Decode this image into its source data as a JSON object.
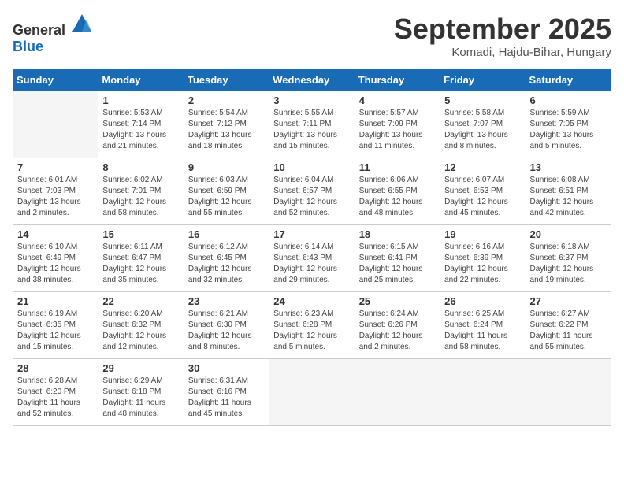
{
  "logo": {
    "text_general": "General",
    "text_blue": "Blue"
  },
  "header": {
    "month": "September 2025",
    "location": "Komadi, Hajdu-Bihar, Hungary"
  },
  "weekdays": [
    "Sunday",
    "Monday",
    "Tuesday",
    "Wednesday",
    "Thursday",
    "Friday",
    "Saturday"
  ],
  "weeks": [
    [
      {
        "day": "",
        "sunrise": "",
        "sunset": "",
        "daylight": ""
      },
      {
        "day": "1",
        "sunrise": "Sunrise: 5:53 AM",
        "sunset": "Sunset: 7:14 PM",
        "daylight": "Daylight: 13 hours and 21 minutes."
      },
      {
        "day": "2",
        "sunrise": "Sunrise: 5:54 AM",
        "sunset": "Sunset: 7:12 PM",
        "daylight": "Daylight: 13 hours and 18 minutes."
      },
      {
        "day": "3",
        "sunrise": "Sunrise: 5:55 AM",
        "sunset": "Sunset: 7:11 PM",
        "daylight": "Daylight: 13 hours and 15 minutes."
      },
      {
        "day": "4",
        "sunrise": "Sunrise: 5:57 AM",
        "sunset": "Sunset: 7:09 PM",
        "daylight": "Daylight: 13 hours and 11 minutes."
      },
      {
        "day": "5",
        "sunrise": "Sunrise: 5:58 AM",
        "sunset": "Sunset: 7:07 PM",
        "daylight": "Daylight: 13 hours and 8 minutes."
      },
      {
        "day": "6",
        "sunrise": "Sunrise: 5:59 AM",
        "sunset": "Sunset: 7:05 PM",
        "daylight": "Daylight: 13 hours and 5 minutes."
      }
    ],
    [
      {
        "day": "7",
        "sunrise": "Sunrise: 6:01 AM",
        "sunset": "Sunset: 7:03 PM",
        "daylight": "Daylight: 13 hours and 2 minutes."
      },
      {
        "day": "8",
        "sunrise": "Sunrise: 6:02 AM",
        "sunset": "Sunset: 7:01 PM",
        "daylight": "Daylight: 12 hours and 58 minutes."
      },
      {
        "day": "9",
        "sunrise": "Sunrise: 6:03 AM",
        "sunset": "Sunset: 6:59 PM",
        "daylight": "Daylight: 12 hours and 55 minutes."
      },
      {
        "day": "10",
        "sunrise": "Sunrise: 6:04 AM",
        "sunset": "Sunset: 6:57 PM",
        "daylight": "Daylight: 12 hours and 52 minutes."
      },
      {
        "day": "11",
        "sunrise": "Sunrise: 6:06 AM",
        "sunset": "Sunset: 6:55 PM",
        "daylight": "Daylight: 12 hours and 48 minutes."
      },
      {
        "day": "12",
        "sunrise": "Sunrise: 6:07 AM",
        "sunset": "Sunset: 6:53 PM",
        "daylight": "Daylight: 12 hours and 45 minutes."
      },
      {
        "day": "13",
        "sunrise": "Sunrise: 6:08 AM",
        "sunset": "Sunset: 6:51 PM",
        "daylight": "Daylight: 12 hours and 42 minutes."
      }
    ],
    [
      {
        "day": "14",
        "sunrise": "Sunrise: 6:10 AM",
        "sunset": "Sunset: 6:49 PM",
        "daylight": "Daylight: 12 hours and 38 minutes."
      },
      {
        "day": "15",
        "sunrise": "Sunrise: 6:11 AM",
        "sunset": "Sunset: 6:47 PM",
        "daylight": "Daylight: 12 hours and 35 minutes."
      },
      {
        "day": "16",
        "sunrise": "Sunrise: 6:12 AM",
        "sunset": "Sunset: 6:45 PM",
        "daylight": "Daylight: 12 hours and 32 minutes."
      },
      {
        "day": "17",
        "sunrise": "Sunrise: 6:14 AM",
        "sunset": "Sunset: 6:43 PM",
        "daylight": "Daylight: 12 hours and 29 minutes."
      },
      {
        "day": "18",
        "sunrise": "Sunrise: 6:15 AM",
        "sunset": "Sunset: 6:41 PM",
        "daylight": "Daylight: 12 hours and 25 minutes."
      },
      {
        "day": "19",
        "sunrise": "Sunrise: 6:16 AM",
        "sunset": "Sunset: 6:39 PM",
        "daylight": "Daylight: 12 hours and 22 minutes."
      },
      {
        "day": "20",
        "sunrise": "Sunrise: 6:18 AM",
        "sunset": "Sunset: 6:37 PM",
        "daylight": "Daylight: 12 hours and 19 minutes."
      }
    ],
    [
      {
        "day": "21",
        "sunrise": "Sunrise: 6:19 AM",
        "sunset": "Sunset: 6:35 PM",
        "daylight": "Daylight: 12 hours and 15 minutes."
      },
      {
        "day": "22",
        "sunrise": "Sunrise: 6:20 AM",
        "sunset": "Sunset: 6:32 PM",
        "daylight": "Daylight: 12 hours and 12 minutes."
      },
      {
        "day": "23",
        "sunrise": "Sunrise: 6:21 AM",
        "sunset": "Sunset: 6:30 PM",
        "daylight": "Daylight: 12 hours and 8 minutes."
      },
      {
        "day": "24",
        "sunrise": "Sunrise: 6:23 AM",
        "sunset": "Sunset: 6:28 PM",
        "daylight": "Daylight: 12 hours and 5 minutes."
      },
      {
        "day": "25",
        "sunrise": "Sunrise: 6:24 AM",
        "sunset": "Sunset: 6:26 PM",
        "daylight": "Daylight: 12 hours and 2 minutes."
      },
      {
        "day": "26",
        "sunrise": "Sunrise: 6:25 AM",
        "sunset": "Sunset: 6:24 PM",
        "daylight": "Daylight: 11 hours and 58 minutes."
      },
      {
        "day": "27",
        "sunrise": "Sunrise: 6:27 AM",
        "sunset": "Sunset: 6:22 PM",
        "daylight": "Daylight: 11 hours and 55 minutes."
      }
    ],
    [
      {
        "day": "28",
        "sunrise": "Sunrise: 6:28 AM",
        "sunset": "Sunset: 6:20 PM",
        "daylight": "Daylight: 11 hours and 52 minutes."
      },
      {
        "day": "29",
        "sunrise": "Sunrise: 6:29 AM",
        "sunset": "Sunset: 6:18 PM",
        "daylight": "Daylight: 11 hours and 48 minutes."
      },
      {
        "day": "30",
        "sunrise": "Sunrise: 6:31 AM",
        "sunset": "Sunset: 6:16 PM",
        "daylight": "Daylight: 11 hours and 45 minutes."
      },
      {
        "day": "",
        "sunrise": "",
        "sunset": "",
        "daylight": ""
      },
      {
        "day": "",
        "sunrise": "",
        "sunset": "",
        "daylight": ""
      },
      {
        "day": "",
        "sunrise": "",
        "sunset": "",
        "daylight": ""
      },
      {
        "day": "",
        "sunrise": "",
        "sunset": "",
        "daylight": ""
      }
    ]
  ]
}
